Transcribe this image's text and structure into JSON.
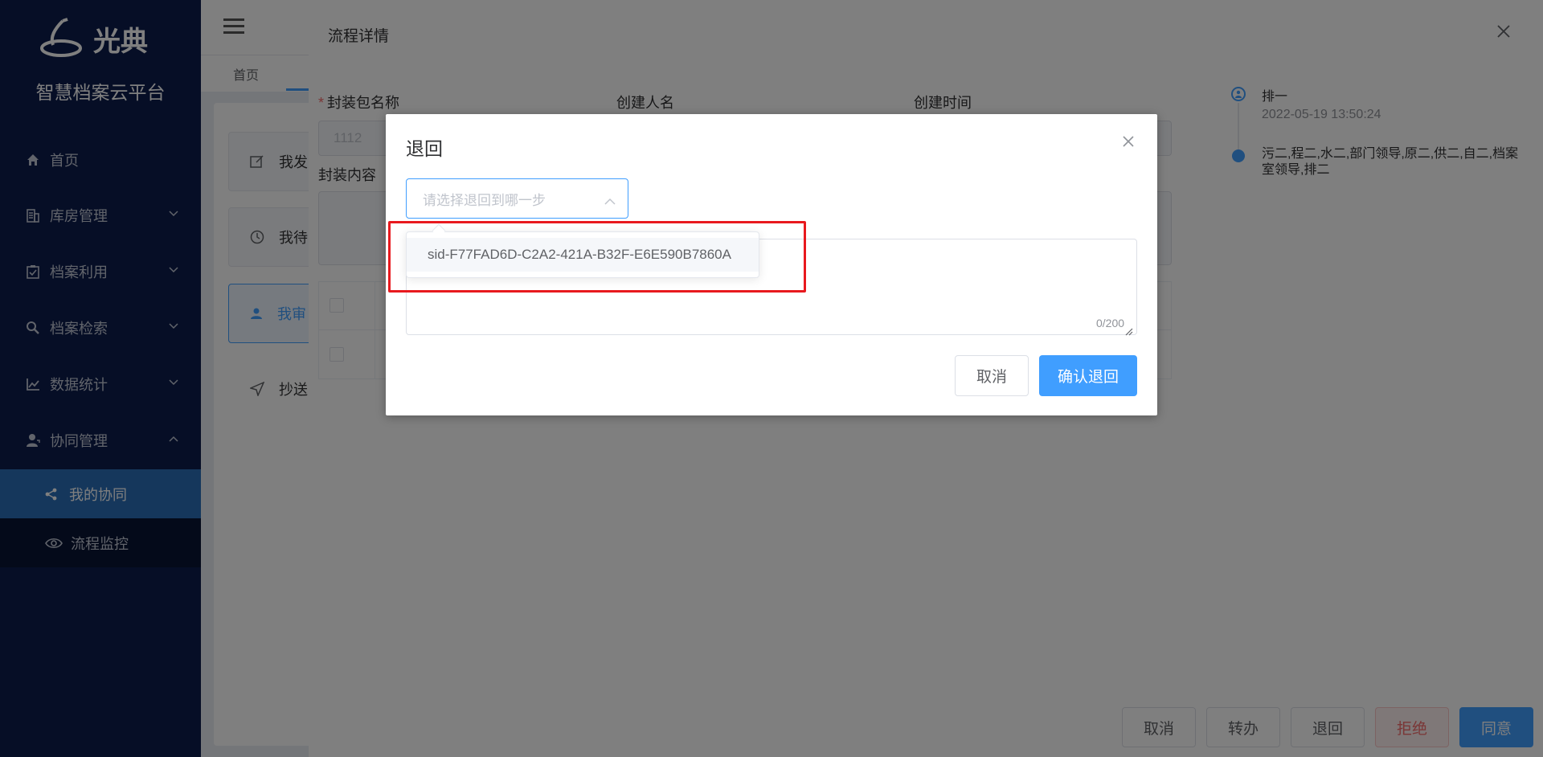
{
  "sidebar": {
    "brand": "光典",
    "platform_name": "智慧档案云平台",
    "items": [
      {
        "label": "首页",
        "icon": "home-icon"
      },
      {
        "label": "库房管理",
        "icon": "building-icon"
      },
      {
        "label": "档案利用",
        "icon": "clipboard-check-icon"
      },
      {
        "label": "档案检索",
        "icon": "search-icon"
      },
      {
        "label": "数据统计",
        "icon": "line-chart-icon"
      },
      {
        "label": "协同管理",
        "icon": "user-tie-icon"
      }
    ],
    "sub_items": [
      {
        "label": "我的协同",
        "icon": "share-icon"
      },
      {
        "label": "流程监控",
        "icon": "eye-icon"
      }
    ],
    "active_sub_color": "#2a6fb8"
  },
  "tabs": {
    "home": "首页"
  },
  "left_panel": {
    "buttons": [
      {
        "label": "我发"
      },
      {
        "label": "我待"
      },
      {
        "label": "我审"
      },
      {
        "label": "抄送"
      }
    ]
  },
  "drawer": {
    "title": "流程详情",
    "package_name_label": "封装包名称",
    "package_name_value": "1112",
    "creator_label": "创建人名",
    "created_time_label": "创建时间",
    "content_label": "封装内容",
    "timeline": [
      {
        "title": "排一",
        "time": "2022-05-19 13:50:24"
      },
      {
        "title": "污二,程二,水二,部门领导,原二,供二,自二,档案室领导,排二"
      }
    ],
    "footer_buttons": {
      "cancel": "取消",
      "transfer": "转办",
      "return": "退回",
      "reject": "拒绝",
      "agree": "同意"
    }
  },
  "dialog": {
    "title": "退回",
    "select_placeholder": "请选择退回到哪一步",
    "options": [
      "sid-F77FAD6D-C2A2-421A-B32F-E6E590B7860A"
    ],
    "counter": "0/200",
    "cancel_label": "取消",
    "confirm_label": "确认退回",
    "primary_color": "#409eff",
    "highlight_color": "#e8191e"
  }
}
